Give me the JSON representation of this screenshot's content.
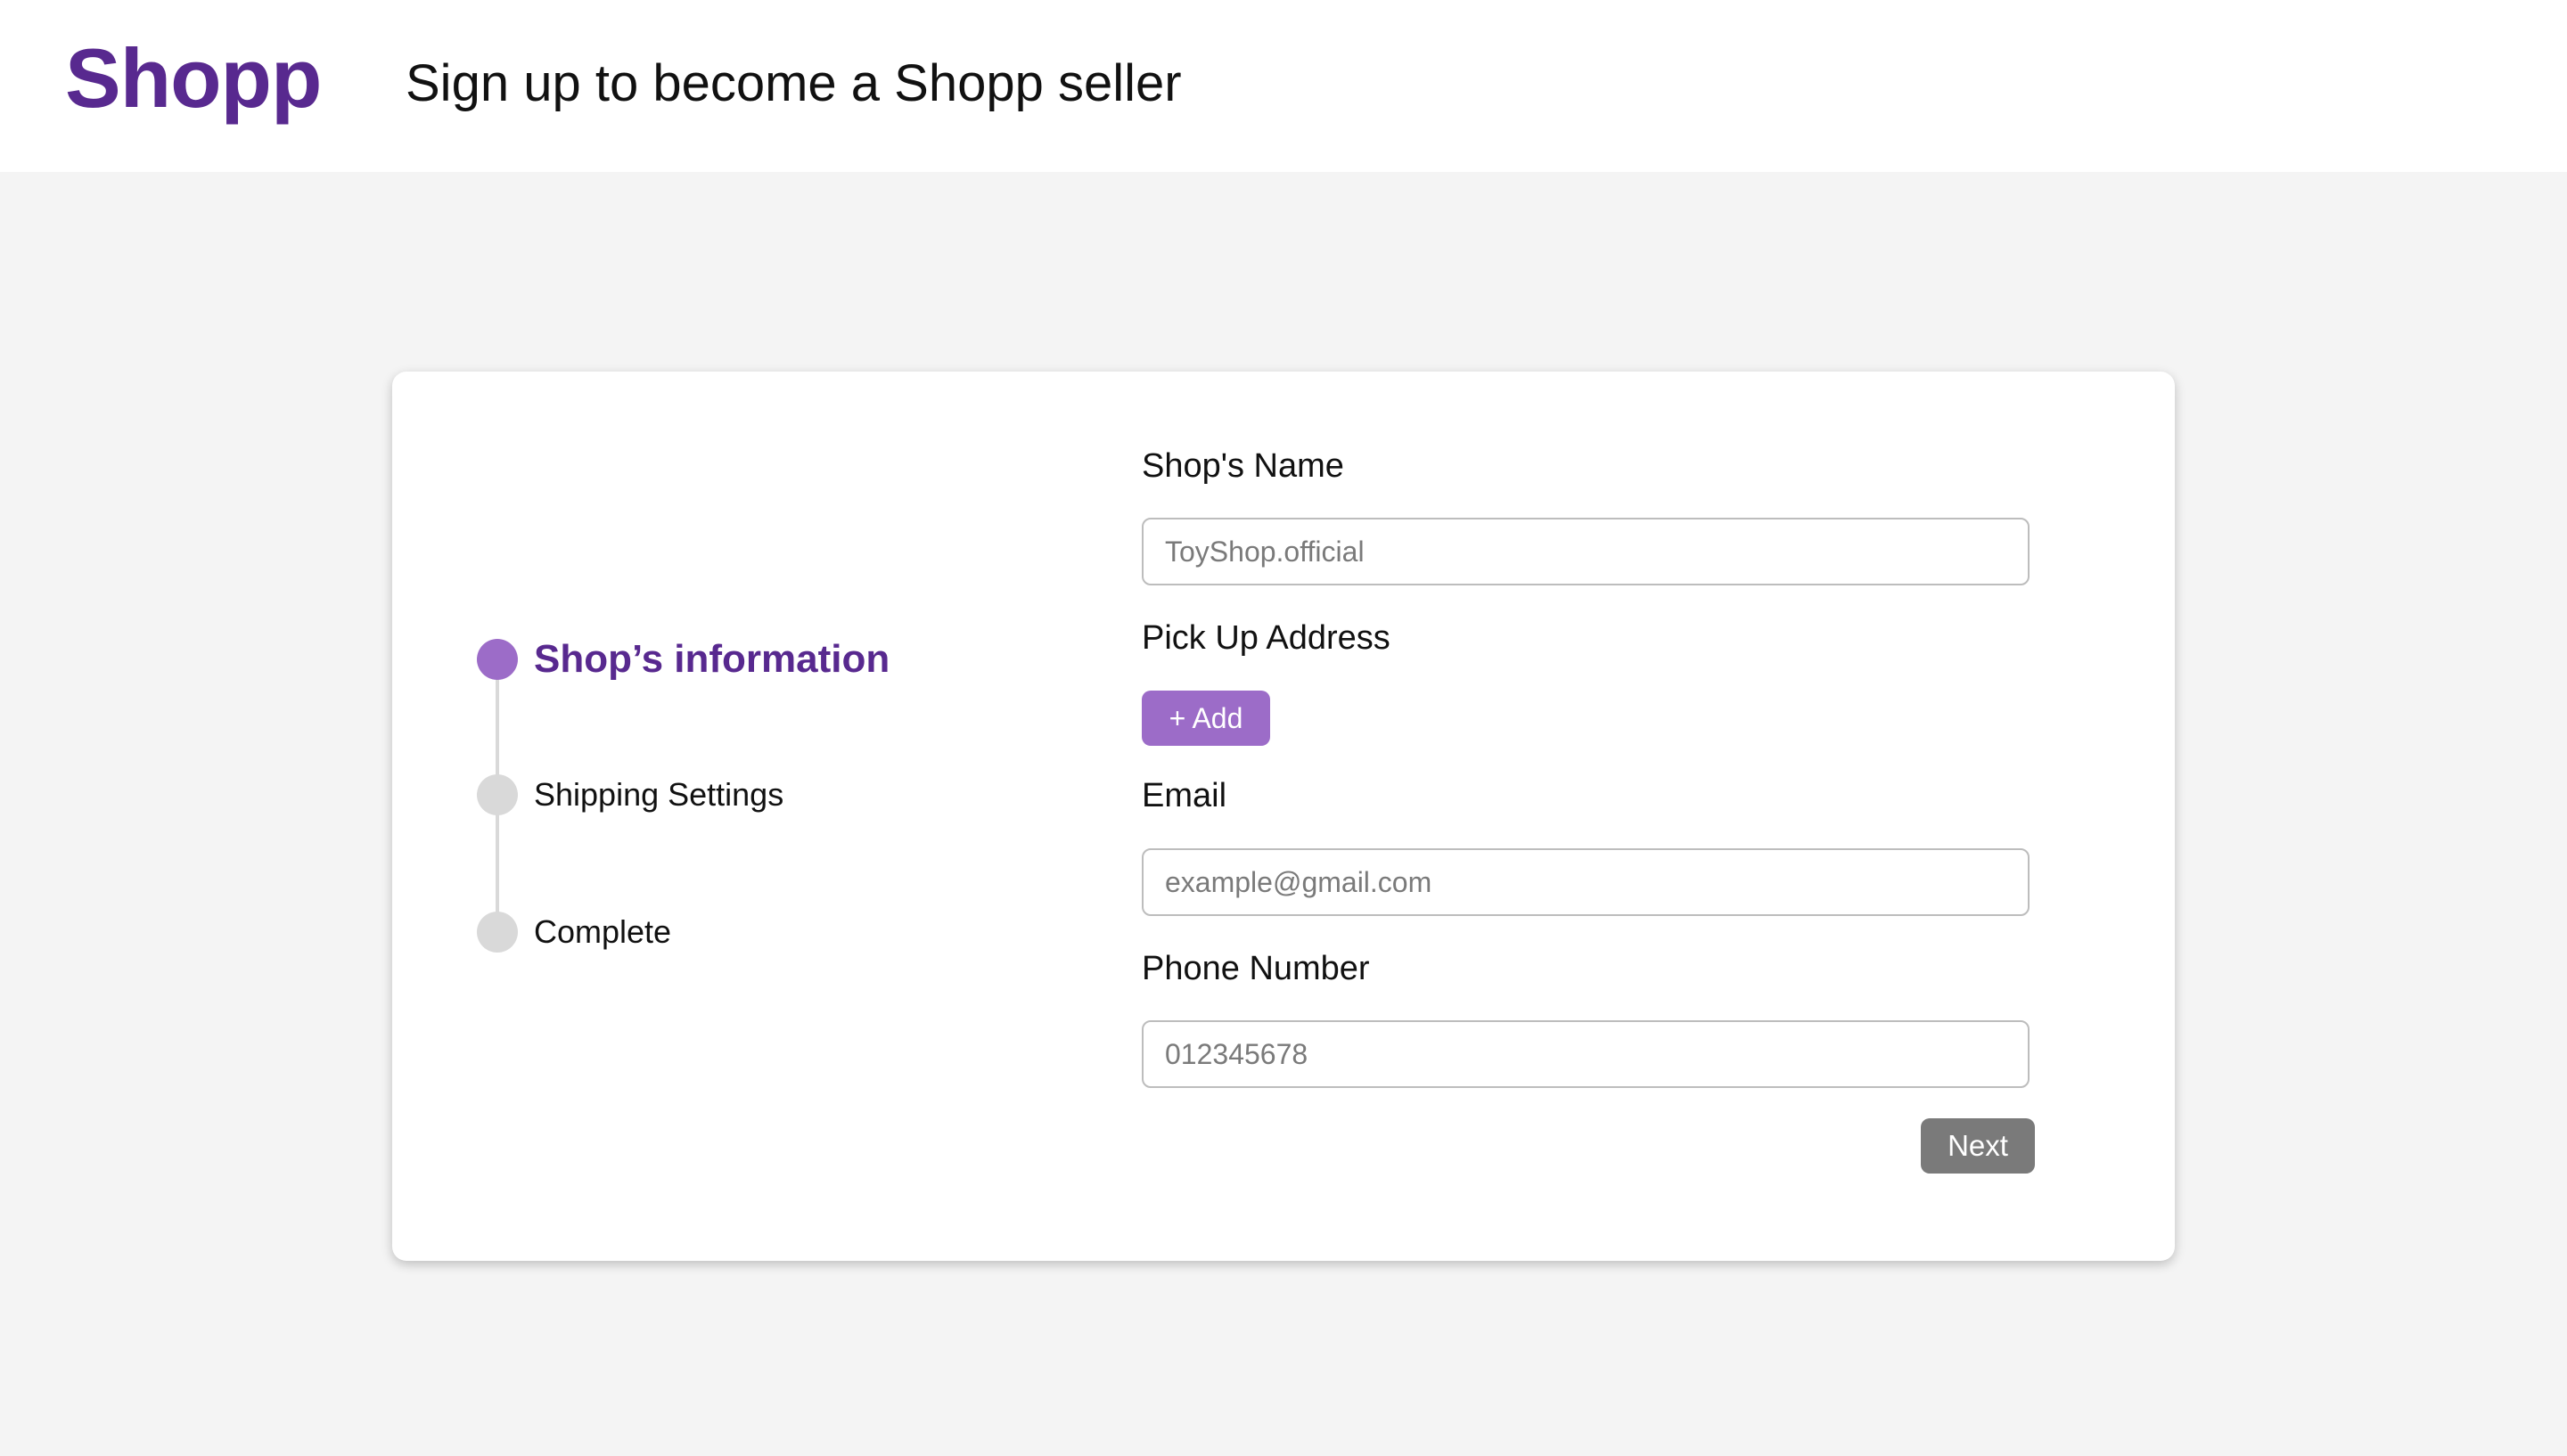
{
  "header": {
    "logo": "Shopp",
    "title": "Sign up to become a Shopp seller"
  },
  "stepper": {
    "steps": [
      {
        "label": "Shop’s information",
        "state": "active"
      },
      {
        "label": "Shipping Settings",
        "state": "inactive"
      },
      {
        "label": "Complete",
        "state": "inactive"
      }
    ]
  },
  "form": {
    "shop_name": {
      "label": "Shop's Name",
      "placeholder": "ToyShop.official",
      "value": ""
    },
    "pickup_address": {
      "label": "Pick Up Address",
      "add_label": "+ Add"
    },
    "email": {
      "label": "Email",
      "placeholder": "example@gmail.com",
      "value": ""
    },
    "phone": {
      "label": "Phone Number",
      "placeholder": "012345678",
      "value": ""
    },
    "next_label": "Next"
  },
  "colors": {
    "brand": "#58298f",
    "accent": "#9c6cc8",
    "inactive": "#d9d9d9",
    "next_button": "#7a7a7a",
    "background": "#f4f4f4"
  }
}
